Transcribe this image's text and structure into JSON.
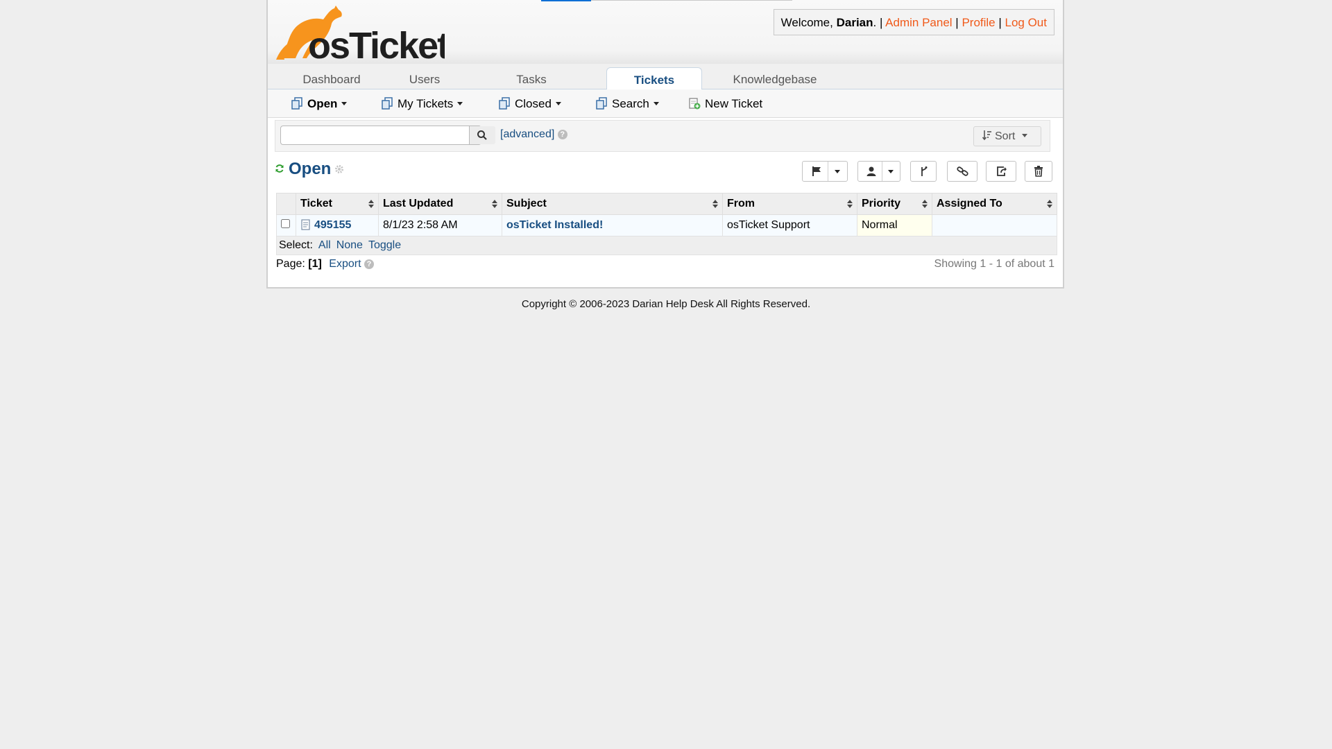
{
  "user_info": {
    "welcome_prefix": "Welcome, ",
    "user_name": "Darian",
    "sep1": ". | ",
    "admin_panel": "Admin Panel",
    "sep2": " | ",
    "profile": "Profile",
    "sep3": " | ",
    "logout": "Log Out"
  },
  "logo_text": "osTicket",
  "nav": {
    "tabs": [
      {
        "label": "Dashboard"
      },
      {
        "label": "Users"
      },
      {
        "label": "Tasks"
      },
      {
        "label": "Tickets",
        "active": true
      },
      {
        "label": "Knowledgebase"
      }
    ]
  },
  "subnav": {
    "open": "Open",
    "my_tickets": "My Tickets",
    "closed": "Closed",
    "search": "Search",
    "new_ticket": "New Ticket"
  },
  "search": {
    "value": "",
    "advanced": "[advanced]",
    "help": "?",
    "sort": "Sort"
  },
  "queue": {
    "title": "Open"
  },
  "table": {
    "headers": [
      "Ticket",
      "Last Updated",
      "Subject",
      "From",
      "Priority",
      "Assigned To"
    ],
    "rows": [
      {
        "ticket": "495155",
        "last_updated": "8/1/23 2:58 AM",
        "subject": "osTicket Installed!",
        "from": "osTicket Support",
        "priority": "Normal",
        "assigned_to": ""
      }
    ],
    "select_label": "Select:",
    "select_all": "All",
    "select_none": "None",
    "select_toggle": "Toggle"
  },
  "pager": {
    "label": "Page:",
    "current": "[1]",
    "export": "Export",
    "showing": "Showing 1 - 1 of about 1"
  },
  "footer": {
    "copyright": "Copyright © 2006-2023 Darian Help Desk All Rights Reserved."
  },
  "colors": {
    "link_blue": "#184e81",
    "accent_orange": "#f05a1a",
    "logo_orange": "#f7941d"
  }
}
